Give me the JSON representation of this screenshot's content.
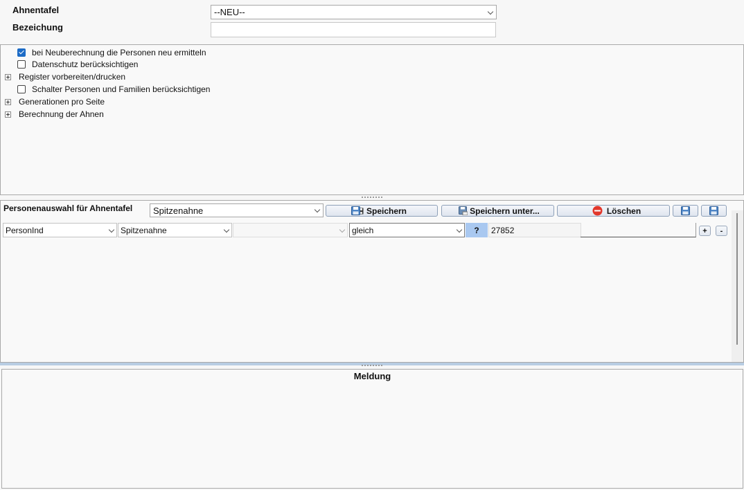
{
  "header": {
    "ahnentafel_label": "Ahnentafel",
    "ahnentafel_value": "--NEU--",
    "bezeichnung_label": "Bezeichung",
    "bezeichnung_value": ""
  },
  "options": {
    "items": [
      {
        "type": "checkbox",
        "checked": true,
        "label": "bei Neuberechnung die Personen neu ermitteln"
      },
      {
        "type": "checkbox",
        "checked": false,
        "label": "Datenschutz berücksichtigen"
      },
      {
        "type": "group",
        "label": "Register vorbereiten/drucken"
      },
      {
        "type": "checkbox",
        "checked": false,
        "label": "Schalter Personen und Familien berücksichtigen"
      },
      {
        "type": "group",
        "label": "Generationen pro Seite"
      },
      {
        "type": "group",
        "label": "Berechnung der Ahnen"
      }
    ]
  },
  "selection": {
    "title": "Personenauswahl für Ahnentafel",
    "preset_value": "Spitzenahne",
    "save_label": "Speichern",
    "save_as_label": "Speichern unter...",
    "delete_label": "Löschen",
    "filter": {
      "field": "PersonInd",
      "attribute": "Spitzenahne",
      "extra": "",
      "operator": "gleich",
      "help": "?",
      "value": "27852",
      "add": "+",
      "remove": "-"
    }
  },
  "message": {
    "title": "Meldung"
  },
  "colors": {
    "accent": "#1c6bc6",
    "delete_icon": "#e2382c",
    "help_bg": "#a9c8f0"
  }
}
